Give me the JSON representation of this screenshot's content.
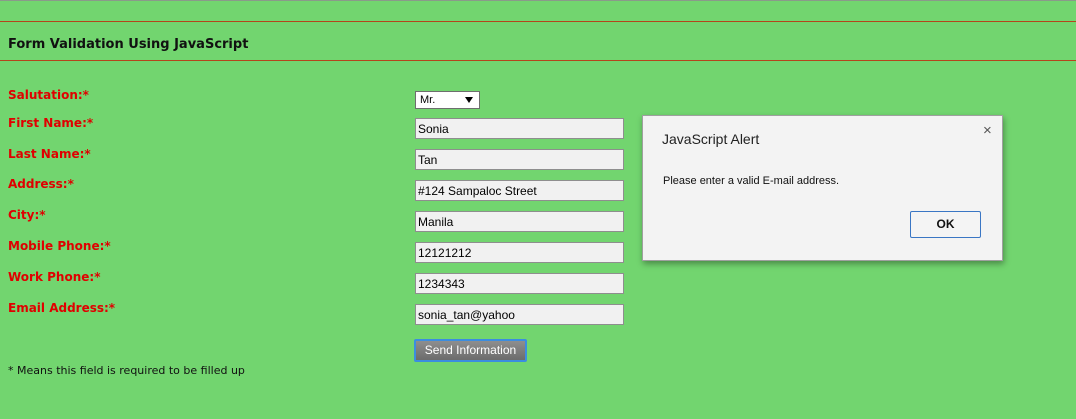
{
  "page": {
    "title": "Form Validation Using JavaScript",
    "footnote": "* Means this field is required to be filled up"
  },
  "form": {
    "salutation": {
      "label": "Salutation:*",
      "selected": "Mr."
    },
    "first_name": {
      "label": "First Name:*",
      "value": "Sonia"
    },
    "last_name": {
      "label": "Last Name:*",
      "value": "Tan"
    },
    "address": {
      "label": "Address:*",
      "value": "#124 Sampaloc Street"
    },
    "city": {
      "label": "City:*",
      "value": "Manila"
    },
    "mobile_phone": {
      "label": "Mobile Phone:*",
      "value": "12121212"
    },
    "work_phone": {
      "label": "Work Phone:*",
      "value": "1234343"
    },
    "email": {
      "label": "Email Address:*",
      "value": "sonia_tan@yahoo"
    },
    "submit_label": "Send Information"
  },
  "alert": {
    "title": "JavaScript Alert",
    "message": "Please enter a valid E-mail address.",
    "ok_label": "OK",
    "close_icon": "×"
  },
  "colors": {
    "background": "#72d56f",
    "label": "#e00000",
    "rule": "#b5451b"
  }
}
